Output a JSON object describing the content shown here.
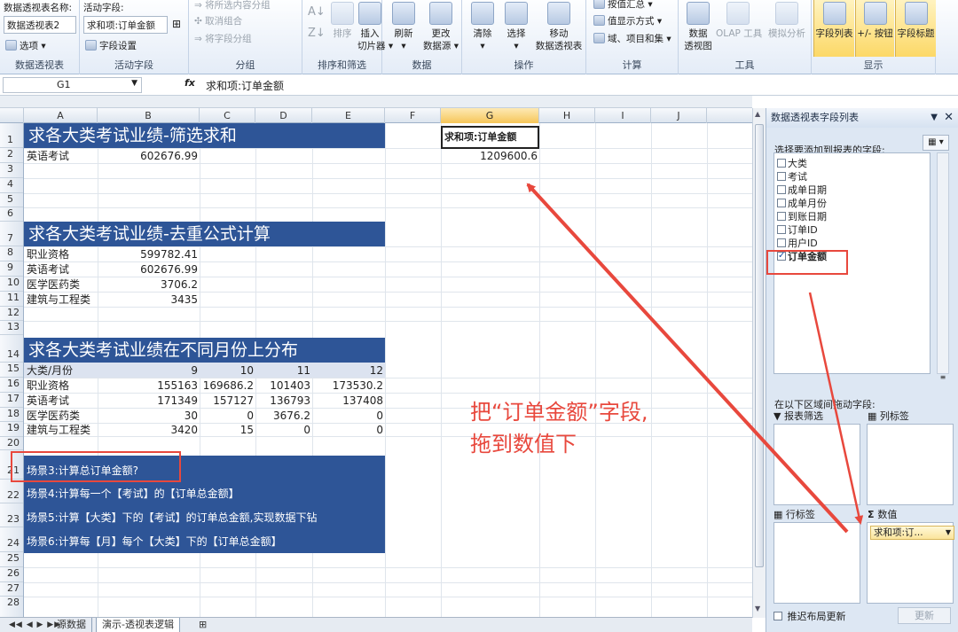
{
  "ribbon": {
    "pivot_name_label": "数据透视表名称:",
    "pivot_name_value": "数据透视表2",
    "options_label": "选项",
    "group_pivot_label": "数据透视表",
    "active_field_label": "活动字段:",
    "active_field_value": "求和项:订单金额",
    "field_settings_label": "字段设置",
    "group_active_label": "活动字段",
    "expand_label": "将所选内容分组",
    "ungroup_label": "取消组合",
    "group_field_label": "将字段分组",
    "group_group_label": "分组",
    "sort_label": "排序",
    "insert_slicer_label": "插入\n切片器",
    "group_sortfilter_label": "排序和筛选",
    "refresh_label": "刷新",
    "change_source_label": "更改\n数据源",
    "group_data_label": "数据",
    "clear_label": "清除",
    "select_label": "选择",
    "move_label": "移动\n数据透视表",
    "group_actions_label": "操作",
    "summarize_label": "按值汇总",
    "show_values_label": "值显示方式",
    "fields_items_label": "域、项目和集",
    "group_calc_label": "计算",
    "pivotchart_label": "数据\n透视图",
    "olap_label": "OLAP 工具",
    "whatif_label": "模拟分析",
    "group_tools_label": "工具",
    "field_list_label": "字段列表",
    "buttons_label": "+/- 按钮",
    "field_headers_label": "字段标题",
    "group_show_label": "显示"
  },
  "formula_bar": {
    "cell_ref": "G1",
    "fx": "fx",
    "formula": "求和项:订单金额"
  },
  "columns": [
    "A",
    "B",
    "C",
    "D",
    "E",
    "F",
    "G",
    "H",
    "I",
    "J"
  ],
  "rows": [
    "1",
    "2",
    "3",
    "4",
    "5",
    "6",
    "7",
    "8",
    "9",
    "10",
    "11",
    "12",
    "13",
    "14",
    "15",
    "16",
    "17",
    "18",
    "19",
    "20",
    "21",
    "22",
    "23",
    "24",
    "25",
    "26",
    "27",
    "28"
  ],
  "sheet": {
    "band1": "求各大类考试业绩-筛选求和",
    "r2_label": "英语考试",
    "r2_value": "602676.99",
    "band2": "求各大类考试业绩-去重公式计算",
    "list2": [
      {
        "label": "职业资格",
        "value": "599782.41"
      },
      {
        "label": "英语考试",
        "value": "602676.99"
      },
      {
        "label": "医学医药类",
        "value": "3706.2"
      },
      {
        "label": "建筑与工程类",
        "value": "3435"
      }
    ],
    "band3": "求各大类考试业绩在不同月份上分布",
    "month_header": {
      "label": "大类/月份",
      "c1": "9",
      "c2": "10",
      "c3": "11",
      "c4": "12"
    },
    "month_rows": [
      {
        "label": "职业资格",
        "c1": "155163",
        "c2": "169686.2",
        "c3": "101403",
        "c4": "173530.2"
      },
      {
        "label": "英语考试",
        "c1": "171349",
        "c2": "157127",
        "c3": "136793",
        "c4": "137408"
      },
      {
        "label": "医学医药类",
        "c1": "30",
        "c2": "0",
        "c3": "3676.2",
        "c4": "0"
      },
      {
        "label": "建筑与工程类",
        "c1": "3420",
        "c2": "15",
        "c3": "0",
        "c4": "0"
      }
    ],
    "scenarios": [
      "场景3:计算总订单金额?",
      "场景4:计算每一个【考试】的【订单总金额】",
      "场景5:计算【大类】下的【考试】的订单总金额,实现数据下钻",
      "场景6:计算每【月】每个【大类】下的【订单总金额】"
    ],
    "pivot_header": "求和项:订单金额",
    "pivot_value": "1209600.6"
  },
  "annotation": {
    "line1": "把“订单金额”字段,",
    "line2": "拖到数值下"
  },
  "sheet_tabs": [
    "源数据",
    "演示-透视表逻辑"
  ],
  "panel": {
    "title": "数据透视表字段列表",
    "choose_label": "选择要添加到报表的字段:",
    "fields": [
      {
        "label": "大类",
        "checked": false
      },
      {
        "label": "考试",
        "checked": false
      },
      {
        "label": "成单日期",
        "checked": false
      },
      {
        "label": "成单月份",
        "checked": false
      },
      {
        "label": "到账日期",
        "checked": false
      },
      {
        "label": "订单ID",
        "checked": false
      },
      {
        "label": "用户ID",
        "checked": false
      },
      {
        "label": "订单金额",
        "checked": true
      }
    ],
    "drag_label": "在以下区域间拖动字段:",
    "filter_label": "报表筛选",
    "col_label": "列标签",
    "row_label": "行标签",
    "values_label": "数值",
    "values_item": "求和项:订...",
    "defer_label": "推迟布局更新",
    "update_label": "更新"
  },
  "colors": {
    "band": "#2e5597",
    "annotation": "#e8483d",
    "highlight": "#fcd867"
  }
}
